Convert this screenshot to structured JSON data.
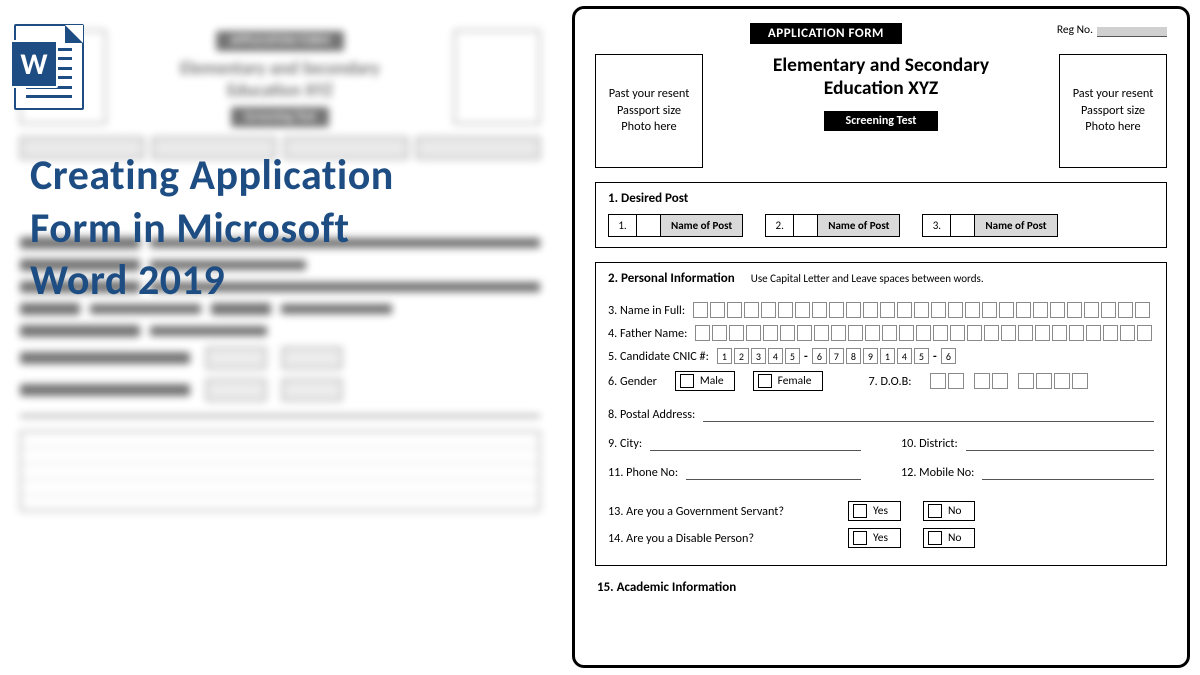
{
  "overlay": {
    "title_l1": "Creating Application",
    "title_l2": "Form in Microsoft",
    "title_l3": "Word 2019",
    "icon_letter": "W"
  },
  "form": {
    "badge": "APPLICATION FORM",
    "reg_label": "Reg No.",
    "photo_text": "Past your resent Passport size Photo here",
    "org_l1": "Elementary and Secondary",
    "org_l2": "Education XYZ",
    "screening": "Screening Test",
    "s1": {
      "heading": "1. Desired Post",
      "posts": [
        {
          "n": "1.",
          "label": "Name of Post"
        },
        {
          "n": "2.",
          "label": "Name of Post"
        },
        {
          "n": "3.",
          "label": "Name of Post"
        }
      ]
    },
    "s2": {
      "heading": "2. Personal Information",
      "hint": "Use Capital Letter and Leave spaces between words.",
      "name": "3. Name in Full:",
      "father": "4. Father Name:",
      "cnic_label": "5. Candidate CNIC #:",
      "cnic": [
        "1",
        "2",
        "3",
        "4",
        "5",
        "-",
        "6",
        "7",
        "8",
        "9",
        "1",
        "4",
        "5",
        "-",
        "6"
      ],
      "gender_label": "6. Gender",
      "male": "Male",
      "female": "Female",
      "dob_label": "7. D.O.B:",
      "addr": "8. Postal Address:",
      "city": "9. City:",
      "district": "10. District:",
      "phone": "11. Phone No:",
      "mobile": "12. Mobile No:",
      "q13": "13. Are you a Government Servant?",
      "q14": "14. Are you a Disable Person?",
      "yes": "Yes",
      "no": "No"
    },
    "s3": "15. Academic Information"
  }
}
